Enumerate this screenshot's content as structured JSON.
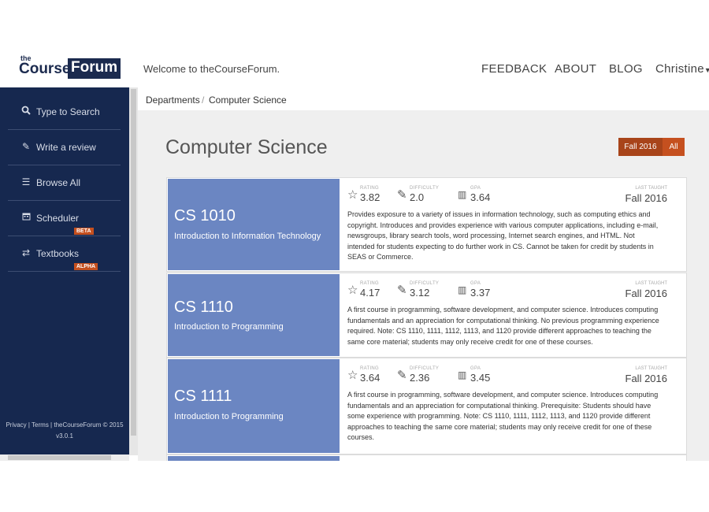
{
  "brand": {
    "the": "the",
    "course": "Course",
    "forum": "Forum"
  },
  "header": {
    "welcome": "Welcome to theCourseForum.",
    "nav": {
      "feedback": "FEEDBACK",
      "about": "ABOUT",
      "blog": "BLOG",
      "user": "Christine"
    }
  },
  "sidebar": {
    "items": [
      {
        "label": "Type to Search",
        "icon": "search-icon"
      },
      {
        "label": "Write a review",
        "icon": "pencil-icon"
      },
      {
        "label": "Browse All",
        "icon": "list-icon"
      },
      {
        "label": "Scheduler",
        "icon": "calendar-icon",
        "badge": "BETA"
      },
      {
        "label": "Textbooks",
        "icon": "exchange-icon",
        "badge": "ALPHA"
      }
    ],
    "footer": "Privacy | Terms | theCourseForum © 2015",
    "version": "v3.0.1"
  },
  "breadcrumb": {
    "first": "Departments",
    "sep": "/",
    "current": "Computer Science"
  },
  "page": {
    "title": "Computer Science",
    "semester_buttons": {
      "active": "Fall 2016",
      "other": "All"
    }
  },
  "labels": {
    "rating": "RATING",
    "difficulty": "DIFFICULTY",
    "gpa": "GPA",
    "last_taught": "LAST TAUGHT"
  },
  "courses": [
    {
      "number": "CS 1010",
      "name": "Introduction to Information Technology",
      "rating": "3.82",
      "difficulty": "2.0",
      "gpa": "3.64",
      "last_taught": "Fall 2016",
      "description": "Provides exposure to a variety of issues in information technology, such as computing ethics and copyright. Introduces and provides experience with various computer applications, including e-mail, newsgroups, library search tools, word processing, Internet search engines, and HTML. Not intended for students expecting to do further work in CS. Cannot be taken for credit by students in SEAS or Commerce."
    },
    {
      "number": "CS 1110",
      "name": "Introduction to Programming",
      "rating": "4.17",
      "difficulty": "3.12",
      "gpa": "3.37",
      "last_taught": "Fall 2016",
      "description": "A first course in programming, software development, and computer science. Introduces computing fundamentals and an appreciation for computational thinking. No previous programming experience required. Note: CS 1110, 1111, 1112, 1113, and 1120 provide different approaches to teaching the same core material; students may only receive credit for one of these courses."
    },
    {
      "number": "CS 1111",
      "name": "Introduction to Programming",
      "rating": "3.64",
      "difficulty": "2.36",
      "gpa": "3.45",
      "last_taught": "Fall 2016",
      "description": "A first course in programming, software development, and computer science. Introduces computing fundamentals and an appreciation for computational thinking. Prerequisite: Students should have some experience with programming. Note: CS 1110, 1111, 1112, 1113, and 1120 provide different approaches to teaching the same core material; students may only receive credit for one of these courses."
    }
  ],
  "colors": {
    "sidebar": "#16284f",
    "tile": "#6b86c2",
    "accent": "#c5501f",
    "accent_dark": "#a8441a"
  }
}
